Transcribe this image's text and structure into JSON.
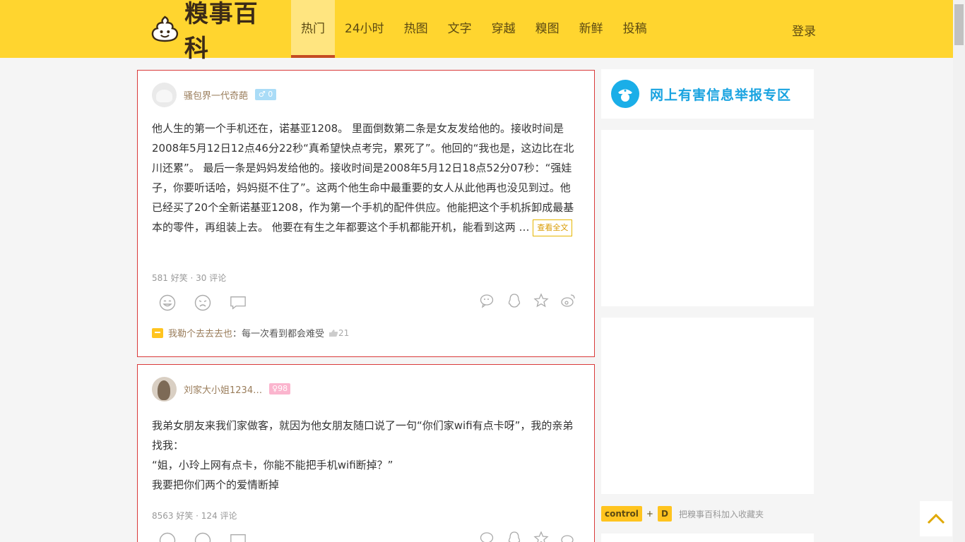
{
  "header": {
    "logo_text": "糗事百科",
    "nav": [
      "热门",
      "24小时",
      "热图",
      "文字",
      "穿越",
      "糗图",
      "新鲜",
      "投稿"
    ],
    "login_label": "登录"
  },
  "articles": [
    {
      "author": "骚包界一代奇葩",
      "badge": "0",
      "content": "他人生的第一个手机还在，诺基亚1208。 里面倒数第二条是女友发给他的。接收时间是2008年5月12日12点46分22秒“真希望快点考完，累死了”。他回的“我也是，这边比在北川还累”。 最后一条是妈妈发给他的。接收时间是2008年5月12日18点52分07秒：“强娃子，你要听话哈，妈妈挺不住了”。这两个他生命中最重要的女人从此他再也没见到过。他已经买了20个全新诺基亚1208，作为第一个手机的配件供应。他能把这个手机拆卸成最基本的零件，再组装上去。 他要在有生之年都要这个手机都能开机，能看到这两 …",
      "read_more": "查看全文",
      "stats": "581 好笑 · 30 评论",
      "hot_comment": {
        "user": "我勒个去去去也",
        "text": "：每一次看到都会难受",
        "likes": "21"
      }
    },
    {
      "author": "刘家大小姐1234…",
      "badge": "98",
      "content": "我弟女朋友来我们家做客，就因为他女朋友随口说了一句“你们家wifi有点卡呀”，我的亲弟找我：\n“姐，小玲上网有点卡，你能不能把手机wifi断掉？”\n我要把你们两个的爱情断掉",
      "stats": "8563 好笑 · 124 评论"
    }
  ],
  "sidebar": {
    "report_text": "网上有害信息举报专区",
    "bookmark": {
      "key1": "control",
      "plus": "+",
      "key2": "D",
      "text": "把糗事百科加入收藏夹"
    }
  },
  "colors": {
    "header_bg": "#ffd52f",
    "accent": "#c54b22",
    "report_blue": "#19a3e0"
  }
}
